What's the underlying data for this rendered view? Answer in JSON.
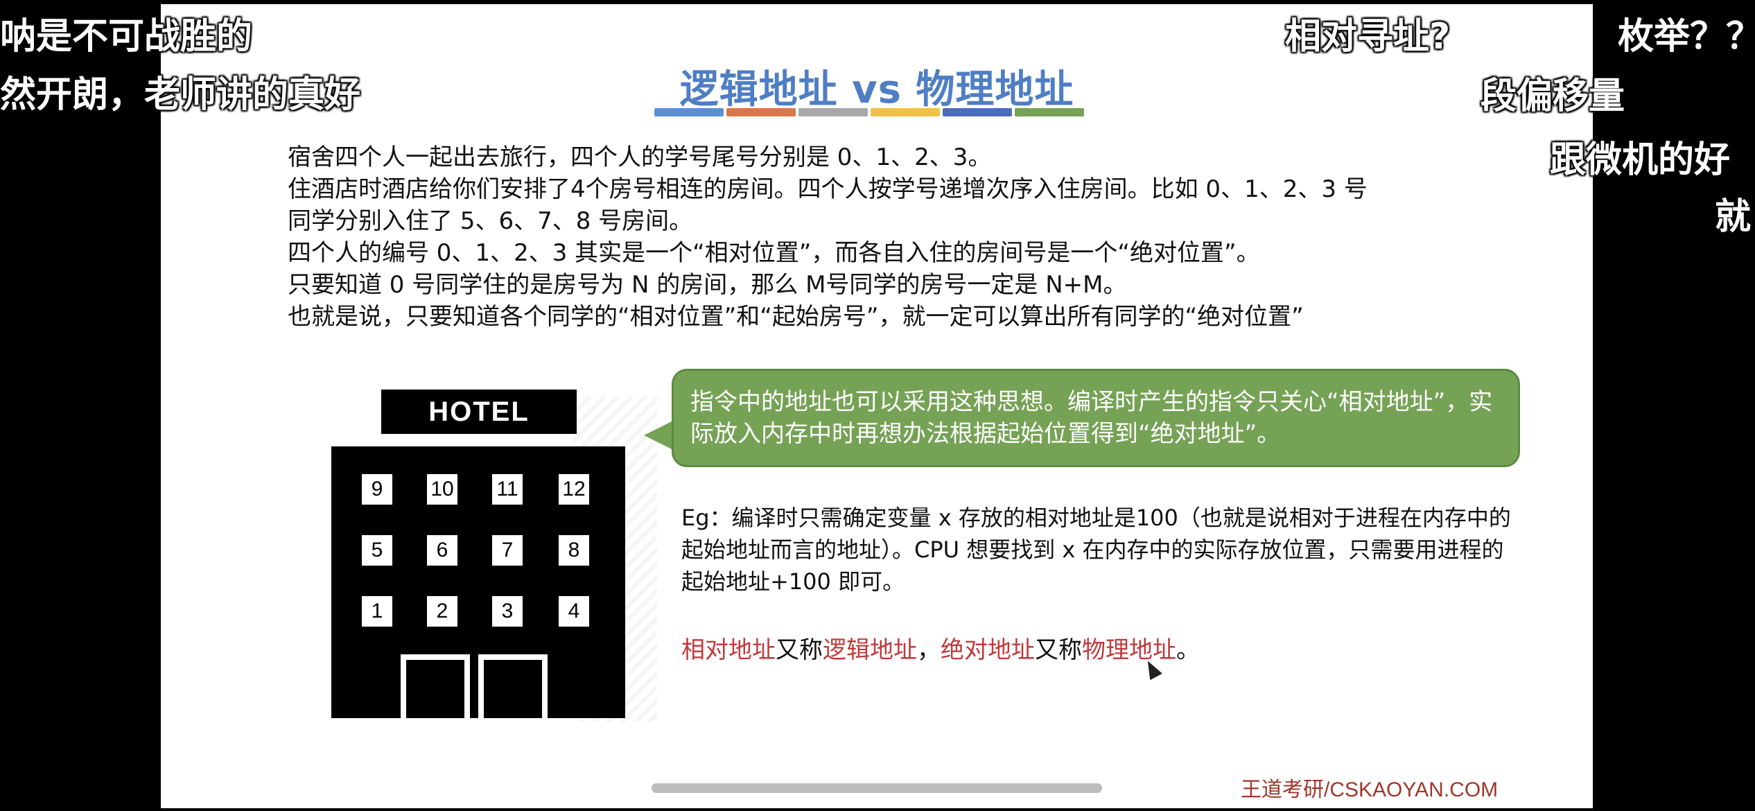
{
  "slide": {
    "title": "逻辑地址 vs 物理地址",
    "title_bar_colors": [
      "#5b8fd1",
      "#d9774a",
      "#a8a8a8",
      "#f2c04a",
      "#4a6fb8",
      "#76a256"
    ],
    "paragraph": [
      "宿舍四个人一起出去旅行，四个人的学号尾号分别是 0、1、2、3。",
      "住酒店时酒店给你们安排了4个房号相连的房间。四个人按学号递增次序入住房间。比如 0、1、2、3 号",
      "同学分别入住了 5、6、7、8 号房间。",
      "四个人的编号 0、1、2、3 其实是一个“相对位置”，而各自入住的房间号是一个“绝对位置”。",
      "只要知道 0 号同学住的是房号为 N 的房间，那么 M号同学的房号一定是 N+M。",
      "也就是说，只要知道各个同学的“相对位置”和“起始房号”，就一定可以算出所有同学的“绝对位置”"
    ],
    "hotel": {
      "sign": "HOTEL",
      "rows": [
        [
          "9",
          "10",
          "11",
          "12"
        ],
        [
          "5",
          "6",
          "7",
          "8"
        ],
        [
          "1",
          "2",
          "3",
          "4"
        ]
      ]
    },
    "callout": "指令中的地址也可以采用这种思想。编译时产生的指令只关心“相对地址”，实际放入内存中时再想办法根据起始位置得到“绝对地址”。",
    "example": "Eg：编译时只需确定变量 x 存放的相对地址是100（也就是说相对于进程在内存中的起始地址而言的地址）。CPU 想要找到 x 在内存中的实际存放位置，只需要用进程的 起始地址+100 即可。",
    "note": {
      "p1": "相对地址",
      "p2": "又称",
      "p3": "逻辑地址",
      "p4": "，",
      "p5": "绝对地址",
      "p6": "又称",
      "p7": "物理地址",
      "p8": "。"
    },
    "brand": "王道考研/CSKAOYAN.COM"
  },
  "danmaku": {
    "d1": "呐是不可战胜的",
    "d2": "然开朗，老师讲的真好",
    "d3": "相对寻址?",
    "d4": "枚举？？",
    "d5": "段偏移量",
    "d6": "跟微机的好",
    "d7": "就"
  }
}
